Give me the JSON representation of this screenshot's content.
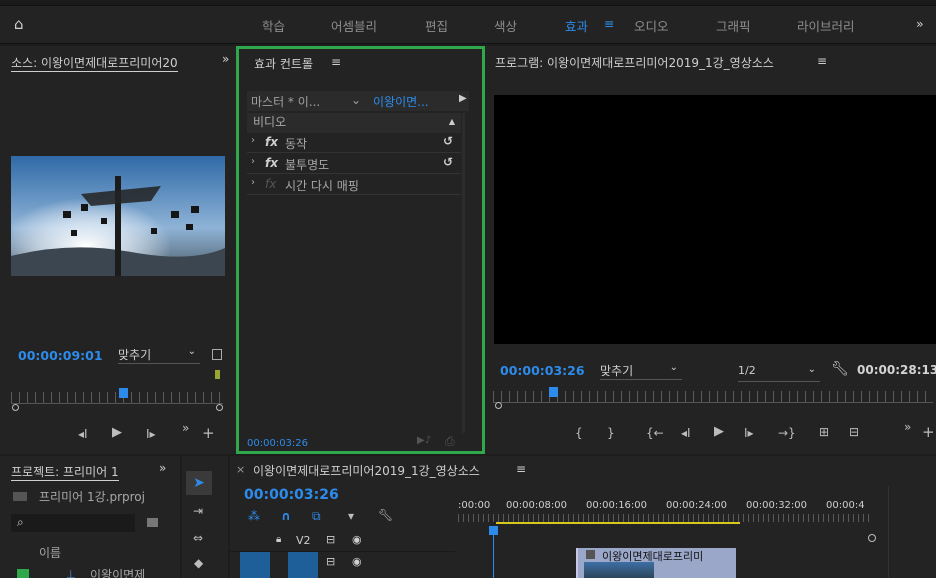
{
  "workspace": {
    "tabs": [
      "학습",
      "어셈블리",
      "편집",
      "색상",
      "효과",
      "오디오",
      "그래픽",
      "라이브러리"
    ],
    "active": "효과",
    "more": "»"
  },
  "source": {
    "title": "소스: 이왕이면제대로프리미어20",
    "more": "»",
    "timecode": "00:00:09:01",
    "fit": "맞추기"
  },
  "effect_controls": {
    "title": "효과 컨트롤",
    "menu": "≡",
    "master": "마스터 * 이...",
    "clip": "이왕이면...",
    "section": "비디오",
    "effects": [
      "동작",
      "불투명도",
      "시간 다시 매핑"
    ],
    "timecode": "00:00:03:26"
  },
  "program": {
    "title": "프로그램: 이왕이면제대로프리미어2019_1강_영상소스",
    "menu": "≡",
    "timecode": "00:00:03:26",
    "fit": "맞추기",
    "quality": "1/2",
    "duration": "00:00:28:13"
  },
  "project": {
    "title": "프로젝트: 프리미어 1",
    "more": "»",
    "file": "프리미어 1강.prproj",
    "column": "이름",
    "item": "이왕이면제"
  },
  "timeline": {
    "title": "이왕이면제대로프리미어2019_1강_영상소스",
    "menu": "≡",
    "timecode": "00:00:03:26",
    "ruler": [
      ":00:00",
      "00:00:08:00",
      "00:00:16:00",
      "00:00:24:00",
      "00:00:32:00",
      "00:00:4"
    ],
    "track": "V2",
    "clip_label": "이왕이면제대로프리미"
  },
  "colors": {
    "accent": "#2d8ceb",
    "highlight": "#2ea84a",
    "bg": "#1d1d1d",
    "panel": "#232323"
  }
}
